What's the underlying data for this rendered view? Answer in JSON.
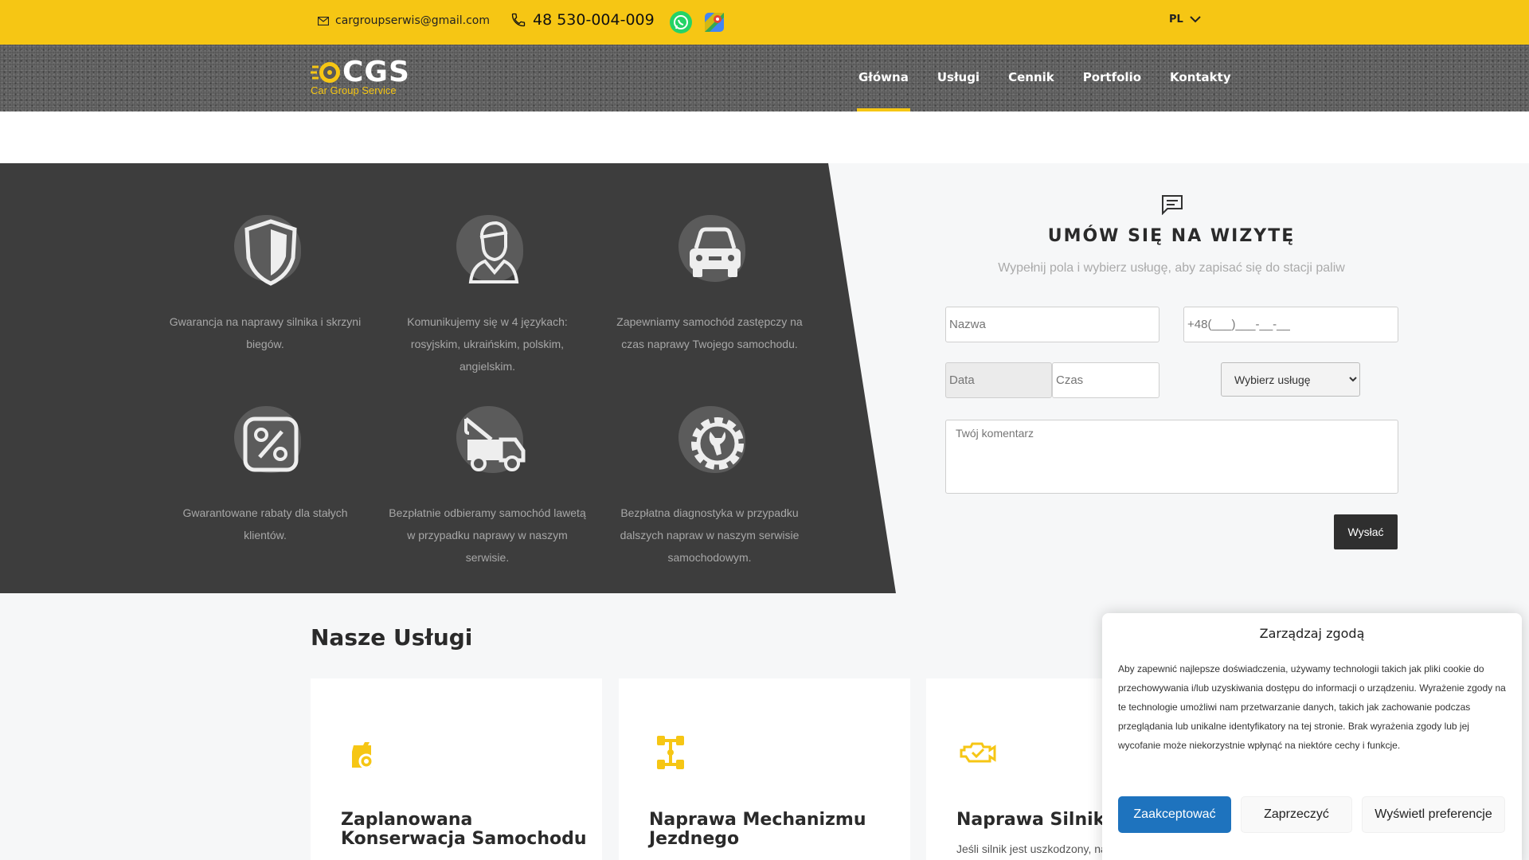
{
  "topbar": {
    "email": "cargroupserwis@gmail.com",
    "phone": "48 530-004-009",
    "language": "PL"
  },
  "logo": {
    "name": "CGS",
    "tagline": "Car Group Service"
  },
  "nav": [
    {
      "label": "Główna",
      "active": true
    },
    {
      "label": "Usługi"
    },
    {
      "label": "Cennik"
    },
    {
      "label": "Portfolio"
    },
    {
      "label": "Kontakty"
    }
  ],
  "features": [
    {
      "icon": "shield-icon",
      "text": "Gwarancja na naprawy silnika i skrzyni biegów."
    },
    {
      "icon": "mechanic-icon",
      "text": "Komunikujemy się w 4 językach: rosyjskim, ukraińskim, polskim, angielskim."
    },
    {
      "icon": "car-icon",
      "text": "Zapewniamy samochód zastępczy na czas naprawy Twojego samochodu."
    },
    {
      "icon": "percent-icon",
      "text": "Gwarantowane rabaty dla stałych klientów."
    },
    {
      "icon": "tow-truck-icon",
      "text": "Bezpłatnie odbieramy samochód lawetą w przypadku naprawy w naszym serwisie."
    },
    {
      "icon": "gear-wrench-icon",
      "text": "Bezpłatna diagnostyka w przypadku dalszych napraw w naszym serwisie samochodowym."
    }
  ],
  "form": {
    "title": "UMÓW SIĘ NA WIZYTĘ",
    "subtitle": "Wypełnij pola i wybierz usługę, aby zapisać się do stacji paliw",
    "name_placeholder": "Nazwa",
    "phone_placeholder": "+48(___)___-__-__",
    "date_placeholder": "Data",
    "time_placeholder": "Czas",
    "service_selected": "Wybierz usługę",
    "comment_placeholder": "Twój komentarz",
    "submit_label": "Wysłać"
  },
  "services": {
    "title": "Nasze Usługi",
    "cards": [
      {
        "icon": "oil-can-icon",
        "title": "Zaplanowana Konserwacja Samochodu",
        "text": ""
      },
      {
        "icon": "chassis-icon",
        "title": "Naprawa Mechanizmu Jezdnego",
        "text": ""
      },
      {
        "icon": "engine-check-icon",
        "title": "Naprawa Silnika",
        "text": "Jeśli silnik jest uszkodzony, natychmiast"
      }
    ]
  },
  "cookie": {
    "title": "Zarządzaj zgodą",
    "body": "Aby zapewnić najlepsze doświadczenia, używamy technologii takich jak pliki cookie do przechowywania i/lub uzyskiwania dostępu do informacji o urządzeniu. Wyrażenie zgody na te technologie umożliwi nam przetwarzanie danych, takich jak zachowanie podczas przeglądania lub unikalne identyfikatory na tej stronie. Brak wyrażenia zgody lub jej wycofanie może niekorzystnie wpłynąć na niektóre cechy i funkcje.",
    "accept_label": "Zaakceptować",
    "deny_label": "Zaprzeczyć",
    "prefs_label": "Wyświetl preferencje"
  },
  "colors": {
    "accent": "#f6c614",
    "dark": "#3d3d3d",
    "button_blue": "#1e73be"
  }
}
